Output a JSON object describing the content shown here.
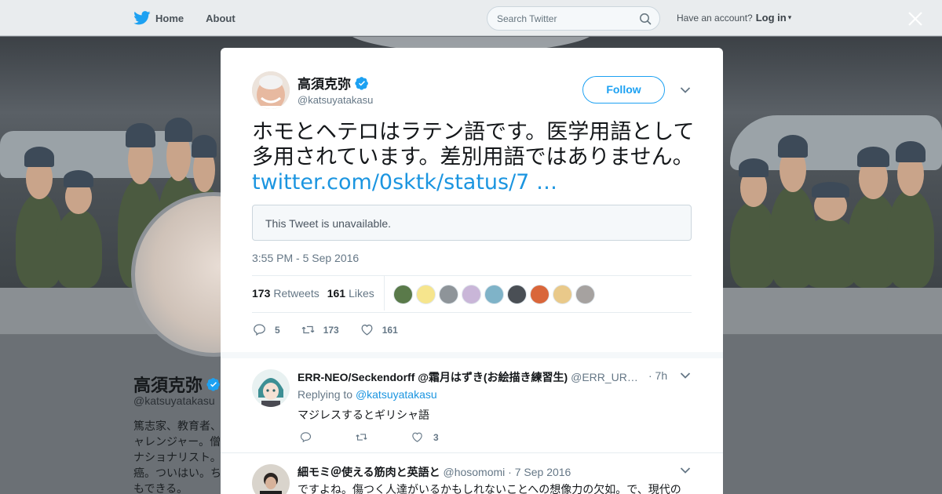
{
  "nav": {
    "home": "Home",
    "about": "About",
    "search_placeholder": "Search Twitter",
    "have_account": "Have an account?",
    "login": "Log in"
  },
  "profile": {
    "name": "高須克弥",
    "handle": "@katsuyatakasu",
    "bio": "篤志家、教育者、\nャレンジャー。僧\nナショナリスト。\n癌。ついはい。ち\nもできる。"
  },
  "tweet": {
    "author_name": "高須克弥",
    "author_handle": "@katsuyatakasu",
    "follow_label": "Follow",
    "text": "ホモとヘテロはラテン語です。医学用語として多用されています。差別用語ではありません。",
    "link": "twitter.com/0sktk/status/7 …",
    "quote_unavailable": "This Tweet is unavailable.",
    "timestamp": "3:55 PM - 5 Sep 2016",
    "retweets_count": "173",
    "retweets_label": "Retweets",
    "likes_count": "161",
    "likes_label": "Likes",
    "reply_count": "5",
    "retweet_action_count": "173",
    "like_action_count": "161",
    "liker_colors": [
      "#5a7a4a",
      "#f6e58d",
      "#8e9499",
      "#c9b6d8",
      "#7fb3c8",
      "#4a4f55",
      "#d9663a",
      "#e9c98a",
      "#a6a2a0"
    ]
  },
  "replies": [
    {
      "name": "ERR-NEO/Seckendorff @霜月はずき(お絵描き練習生)",
      "handle": "@ERR_UR…",
      "time": "· 7h",
      "replying_prefix": "Replying to",
      "replying_to": "@katsuyatakasu",
      "text": "マジレスするとギリシャ語",
      "reply_count": "",
      "retweet_count": "",
      "like_count": "3"
    },
    {
      "name": "細モミ＠使える筋肉と英語と",
      "handle": "@hosomomi",
      "time": "· 7 Sep 2016",
      "text": "ですよね。傷つく人達がいるかもしれないことへの想像力の欠如。で、現代の"
    }
  ]
}
